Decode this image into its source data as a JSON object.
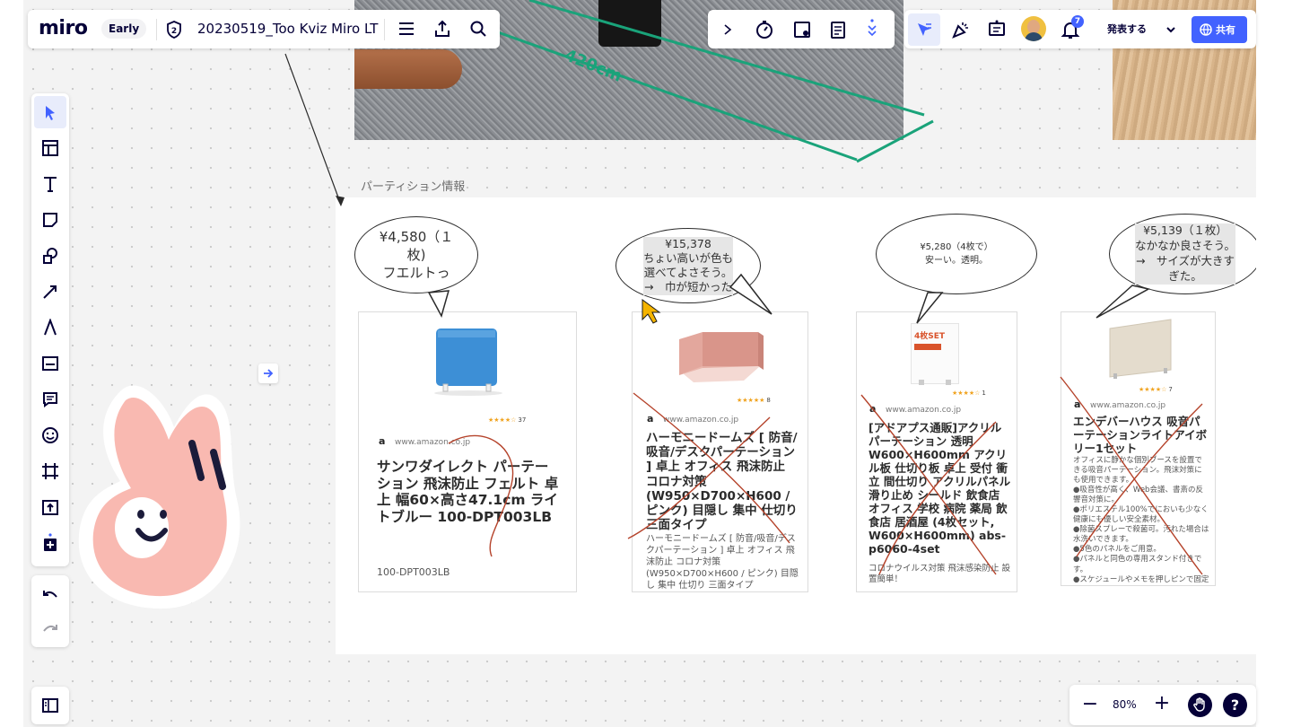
{
  "header": {
    "logo": "miro",
    "plan_badge": "Early",
    "board_title": "20230519_Too Kviz Miro LT",
    "present_label": "発表する",
    "share_label": "共有",
    "notification_count": "7"
  },
  "left_toolbar": {
    "tools": [
      "select-icon",
      "templates-icon",
      "text-icon",
      "sticky-note-icon",
      "shapes-icon",
      "connection-line-icon",
      "pen-icon",
      "frame-card-icon",
      "comment-icon",
      "emoji-icon",
      "frame-icon",
      "upload-icon",
      "more-apps-icon"
    ],
    "active_tool": "select-icon"
  },
  "photo": {
    "measurement": "420cm"
  },
  "frame": {
    "title": "パーティション情報"
  },
  "cards": [
    {
      "price_bubble": "¥4,580（１\n枚)\nフエルトっ",
      "stars": "★★★★☆",
      "review_count": "37",
      "source": "www.amazon.co.jp",
      "title": "サンワダイレクト パーテーション 飛沫防止 フェルト 卓上 幅60×高さ47.1cm ライトブルー 100-DPT003LB",
      "subtitle": "100-DPT003LB"
    },
    {
      "price_bubble": "¥15,378\nちょい高いが色も\n選べてよさそう。\n→　巾が短かった",
      "stars": "★★★★★",
      "review_count": "8",
      "source": "www.amazon.co.jp",
      "title": "ハーモニードームズ [ 防音/吸音/デスクパーテーション ] 卓上 オフィス 飛沫防止 コロナ対策 (W950×D700×H600 / ピンク) 目隠し 集中 仕切り 三面タイプ",
      "subtitle": "ハーモニードームズ [ 防音/吸音/デスクパーテーション ] 卓上 オフィス 飛沫防止 コロナ対策 (W950×D700×H600 / ピンク) 目隠し 集中 仕切り 三面タイプ"
    },
    {
      "price_bubble": "¥5,280（4枚で）\n安ーい。透明。",
      "stars": "★★★★☆",
      "review_count": "1",
      "source": "www.amazon.co.jp",
      "title": "[アドアプス通販]アクリルパーテーション 透明 W600×H600mm アクリル板 仕切り板 卓上 受付 衝立 間仕切り アクリルパネル 滑り止め シールド 飲食店 オフィス 学校 病院 薬局 飲食店 居酒屋 (4枚セット, W600×H600mm) abs-p6060-4set",
      "subtitle": "コロナウイルス対策 飛沫感染防止 設置簡単！",
      "product_label": "4枚SET"
    },
    {
      "price_bubble": "¥5,139（１枚）\nなかなか良さそう。\n→　サイズが大きす\nぎた。",
      "stars": "★★★★☆",
      "review_count": "7",
      "source": "www.amazon.co.jp",
      "title": "エンデバーハウス 吸音パーテーションライトアイボリー1セット",
      "subtitle": "オフィスに静かな個別ブースを設置できる吸音パーテーション。飛沫対策にも使用できます。\n●吸音性が高く、Web会議、書斎の反響音対策に。\n●ポリエステル100%でにおいも少なく健康にも優しい安全素材。\n●除菌スプレーで殺菌可。汚れた場合は水洗いできます。\n●5色のパネルをご用意。\n●パネルと同色の専用スタンド付きです。\n●スケジュールやメモを押しピンで固定できます。"
    }
  ],
  "bottom_bar": {
    "zoom": "80%",
    "zoom_out": "−",
    "zoom_in": "+",
    "help": "?"
  },
  "colors": {
    "accent": "#4262ff",
    "miro_dark": "#050038",
    "strike": "#b5432b",
    "green_line": "#1aa37a",
    "bubble_border": "#2b2b2b"
  }
}
